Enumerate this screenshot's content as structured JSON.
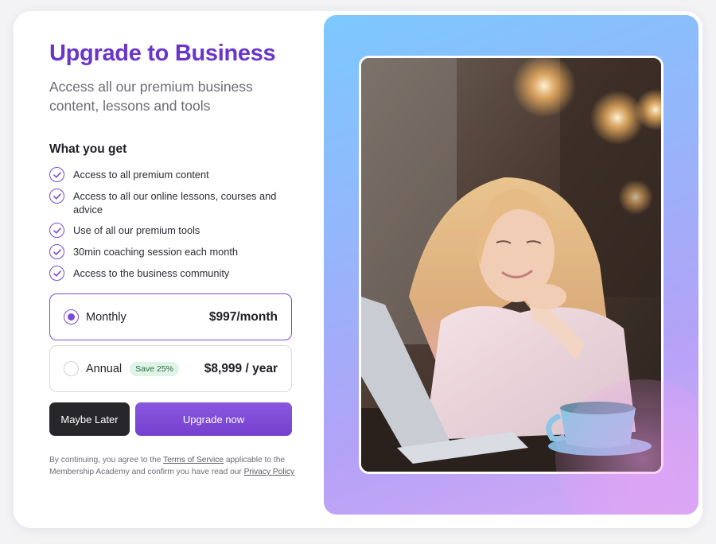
{
  "header": {
    "title": "Upgrade to Business",
    "subtitle": "Access all our premium business content, lessons and tools"
  },
  "benefits": {
    "title": "What you get",
    "items": [
      {
        "label": "Access to all premium content"
      },
      {
        "label": "Access to all our online lessons, courses and advice"
      },
      {
        "label": "Use of all our premium tools"
      },
      {
        "label": "30min coaching session each month"
      },
      {
        "label": "Access to the business community"
      }
    ]
  },
  "plans": {
    "monthly": {
      "label": "Monthly",
      "price": "$997/month",
      "selected": true
    },
    "annual": {
      "label": "Annual",
      "badge": "Save 25%",
      "price": "$8,999 / year",
      "selected": false
    }
  },
  "actions": {
    "later_label": "Maybe Later",
    "upgrade_label": "Upgrade now"
  },
  "legal": {
    "prefix": "By continuing, you agree to the",
    "terms_link": "Terms of Service",
    "middle": "applicable to the Membership Academy and confirm you have read our",
    "privacy_link": "Privacy Policy"
  },
  "colors": {
    "accent": "#6a35c9",
    "button_primary": "#7c4ad8",
    "button_secondary": "#27272b",
    "badge_bg": "#dff3e6"
  },
  "icons": {
    "benefit_icon": "check-circle-icon"
  }
}
